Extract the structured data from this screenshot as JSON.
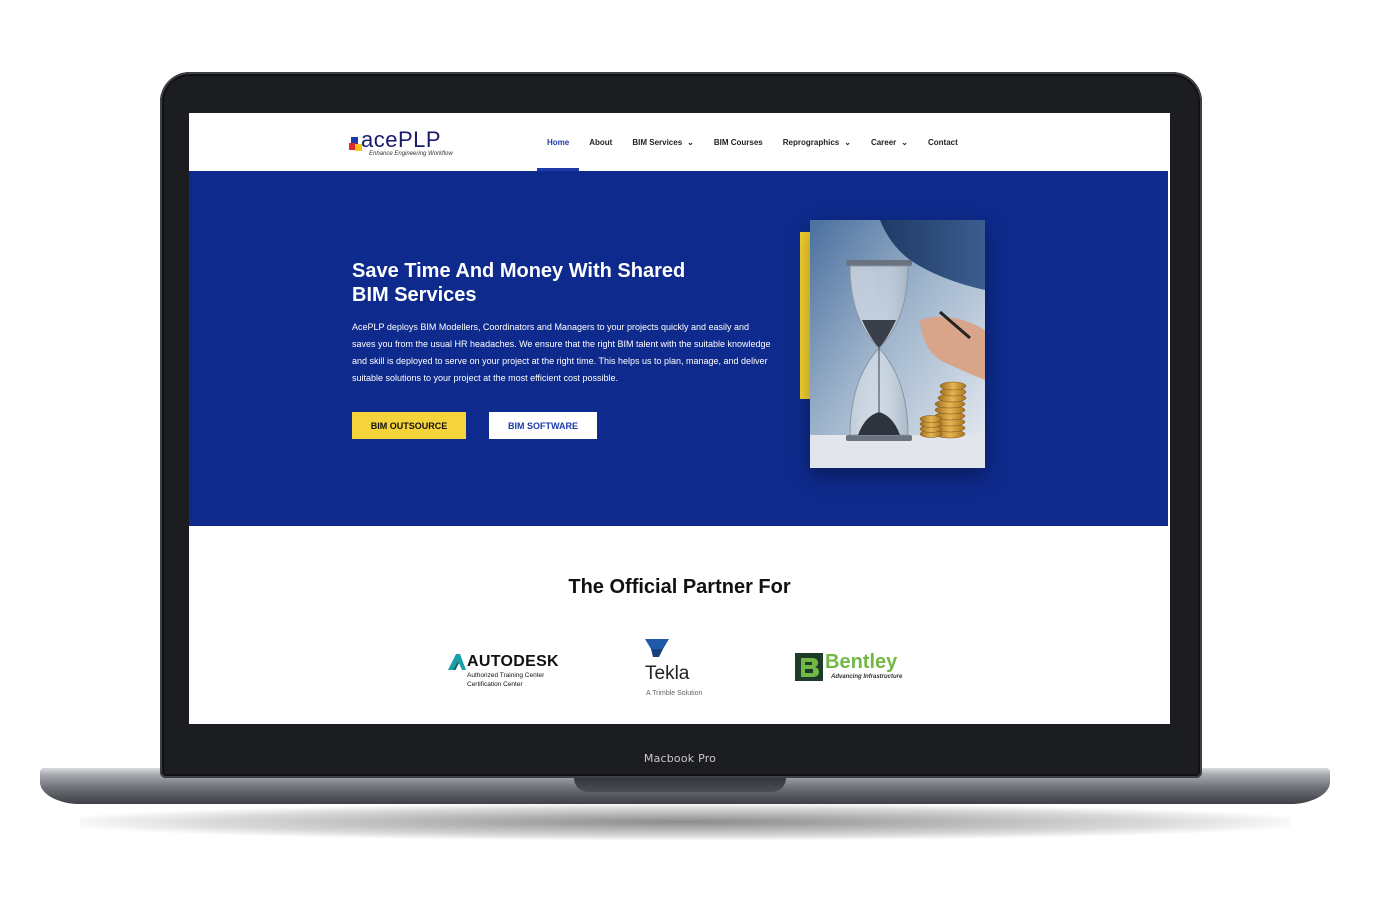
{
  "device": {
    "label": "Macbook Pro"
  },
  "logo": {
    "text": "acePLP",
    "tagline": "Enhance Engineering Workflow"
  },
  "nav": {
    "items": [
      {
        "label": "Home",
        "active": true,
        "dropdown": false
      },
      {
        "label": "About",
        "active": false,
        "dropdown": false
      },
      {
        "label": "BIM Services",
        "active": false,
        "dropdown": true
      },
      {
        "label": "BIM Courses",
        "active": false,
        "dropdown": false
      },
      {
        "label": "Reprographics",
        "active": false,
        "dropdown": true
      },
      {
        "label": "Career",
        "active": false,
        "dropdown": true
      },
      {
        "label": "Contact",
        "active": false,
        "dropdown": false
      }
    ]
  },
  "hero": {
    "title_line1": "Save Time And Money With Shared",
    "title_line2": "BIM Services",
    "body": "AcePLP deploys BIM Modellers, Coordinators and Managers to your projects quickly and easily and saves you from the usual HR headaches. We ensure that the right BIM talent with the suitable knowledge and skill is deployed to serve on your project at the right time. This helps us to plan, manage, and deliver suitable solutions to your project at the most efficient cost possible.",
    "primary_button": "BIM OUTSOURCE",
    "secondary_button": "BIM SOFTWARE",
    "image_icon": "hourglass-coins-image"
  },
  "partners": {
    "title": "The Official Partner For",
    "autodesk": {
      "name": "AUTODESK",
      "sub1": "Authorized Training Center",
      "sub2": "Certification Center"
    },
    "tekla": {
      "name": "Tekla",
      "sub": "A Trimble Solution"
    },
    "bentley": {
      "name": "Bentley",
      "sub": "Advancing Infrastructure"
    }
  },
  "colors": {
    "brand_blue": "#0e2a8c",
    "accent_yellow": "#f5d43b",
    "nav_active": "#1c3aa9",
    "bentley_green": "#72b845"
  }
}
